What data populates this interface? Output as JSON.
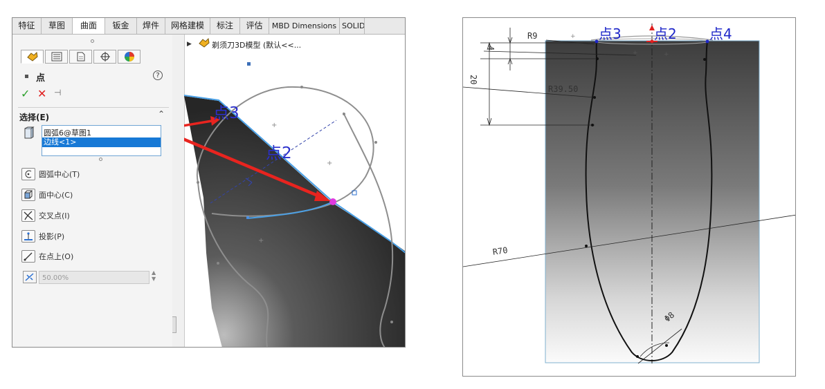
{
  "left_panel": {
    "tabs": [
      {
        "label": "特征",
        "active": false
      },
      {
        "label": "草图",
        "active": false
      },
      {
        "label": "曲面",
        "active": true
      },
      {
        "label": "钣金",
        "active": false
      },
      {
        "label": "焊件",
        "active": false
      },
      {
        "label": "网格建模",
        "active": false
      },
      {
        "label": "标注",
        "active": false
      },
      {
        "label": "评估",
        "active": false
      },
      {
        "label": "MBD Dimensions",
        "active": false
      },
      {
        "label": "SOLID",
        "active": false
      }
    ],
    "feature_title": "点",
    "help_icon": "question-circle-icon",
    "section_selection_label": "选择(E)",
    "selection_items": [
      "圆弧6@草图1",
      "边线<1>"
    ],
    "reference_types": [
      {
        "label": "圆弧中心(T)",
        "icon": "arc-center-icon"
      },
      {
        "label": "面中心(C)",
        "icon": "face-center-icon"
      },
      {
        "label": "交叉点(I)",
        "icon": "intersection-icon"
      },
      {
        "label": "投影(P)",
        "icon": "projection-icon"
      },
      {
        "label": "在点上(O)",
        "icon": "on-point-icon"
      }
    ],
    "distance_value": "50.00%",
    "tree_root_label": "剃须刀3D模型 (默认<<...",
    "callouts": {
      "point3": "点3",
      "point2": "点2"
    },
    "colors": {
      "accent_blue": "#1779d6",
      "arrow_red": "#e8241f",
      "edge_blue": "#4aa0e6",
      "point_magenta": "#e03adf"
    }
  },
  "right_panel": {
    "point_labels": [
      "点3",
      "点2",
      "点4"
    ],
    "dimensions": {
      "r9": "R9",
      "d4": "4",
      "d20": "20",
      "r39_50": "R39.50",
      "r70": "R70",
      "phi8": "Φ8"
    }
  }
}
